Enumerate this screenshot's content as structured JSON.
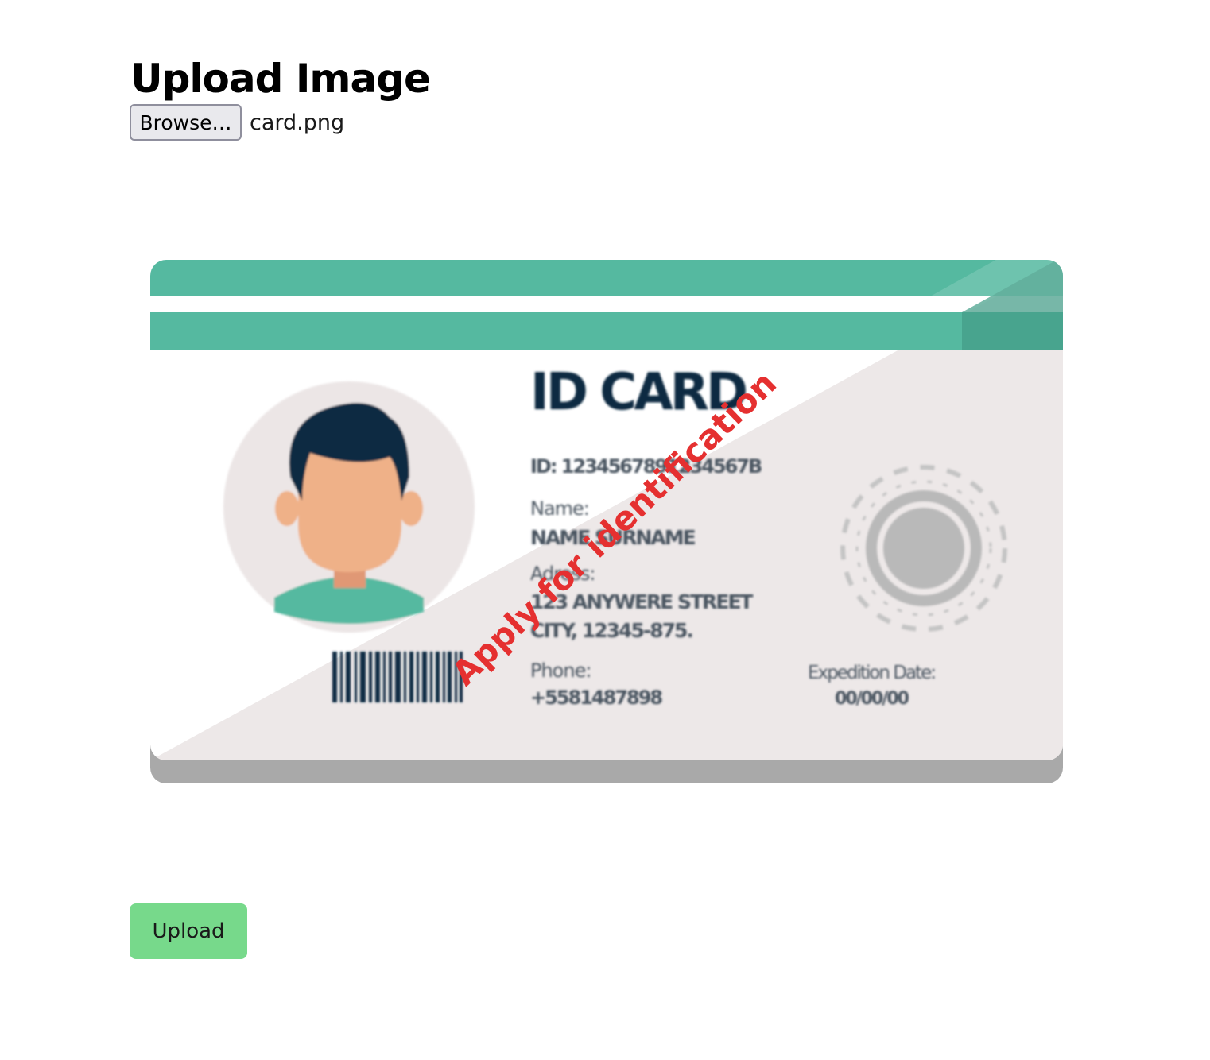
{
  "page": {
    "title": "Upload Image"
  },
  "file_input": {
    "button_label": "Browse…",
    "file_name": "card.png"
  },
  "preview": {
    "card_title": "ID CARD",
    "id_line": "ID: 1234567891234567B",
    "name_label": "Name:",
    "name_value": "NAME SURNAME",
    "address_label": "Adress:",
    "address_line1": "123 ANYWERE STREET",
    "address_line2": "CITY, 12345-875.",
    "phone_label": "Phone:",
    "phone_value": "+5581487898",
    "expedition_label": "Expedition Date:",
    "expedition_value": "00/00/00",
    "watermark": "Apply for identification",
    "colors": {
      "teal": "#55b9a0",
      "teal_dark": "#47a08b",
      "card_gray": "#ede8e8",
      "navy": "#0e2a42",
      "skin": "#efb188",
      "watermark_red": "#e53030"
    }
  },
  "upload_button": {
    "label": "Upload",
    "color": "#77d98b"
  }
}
